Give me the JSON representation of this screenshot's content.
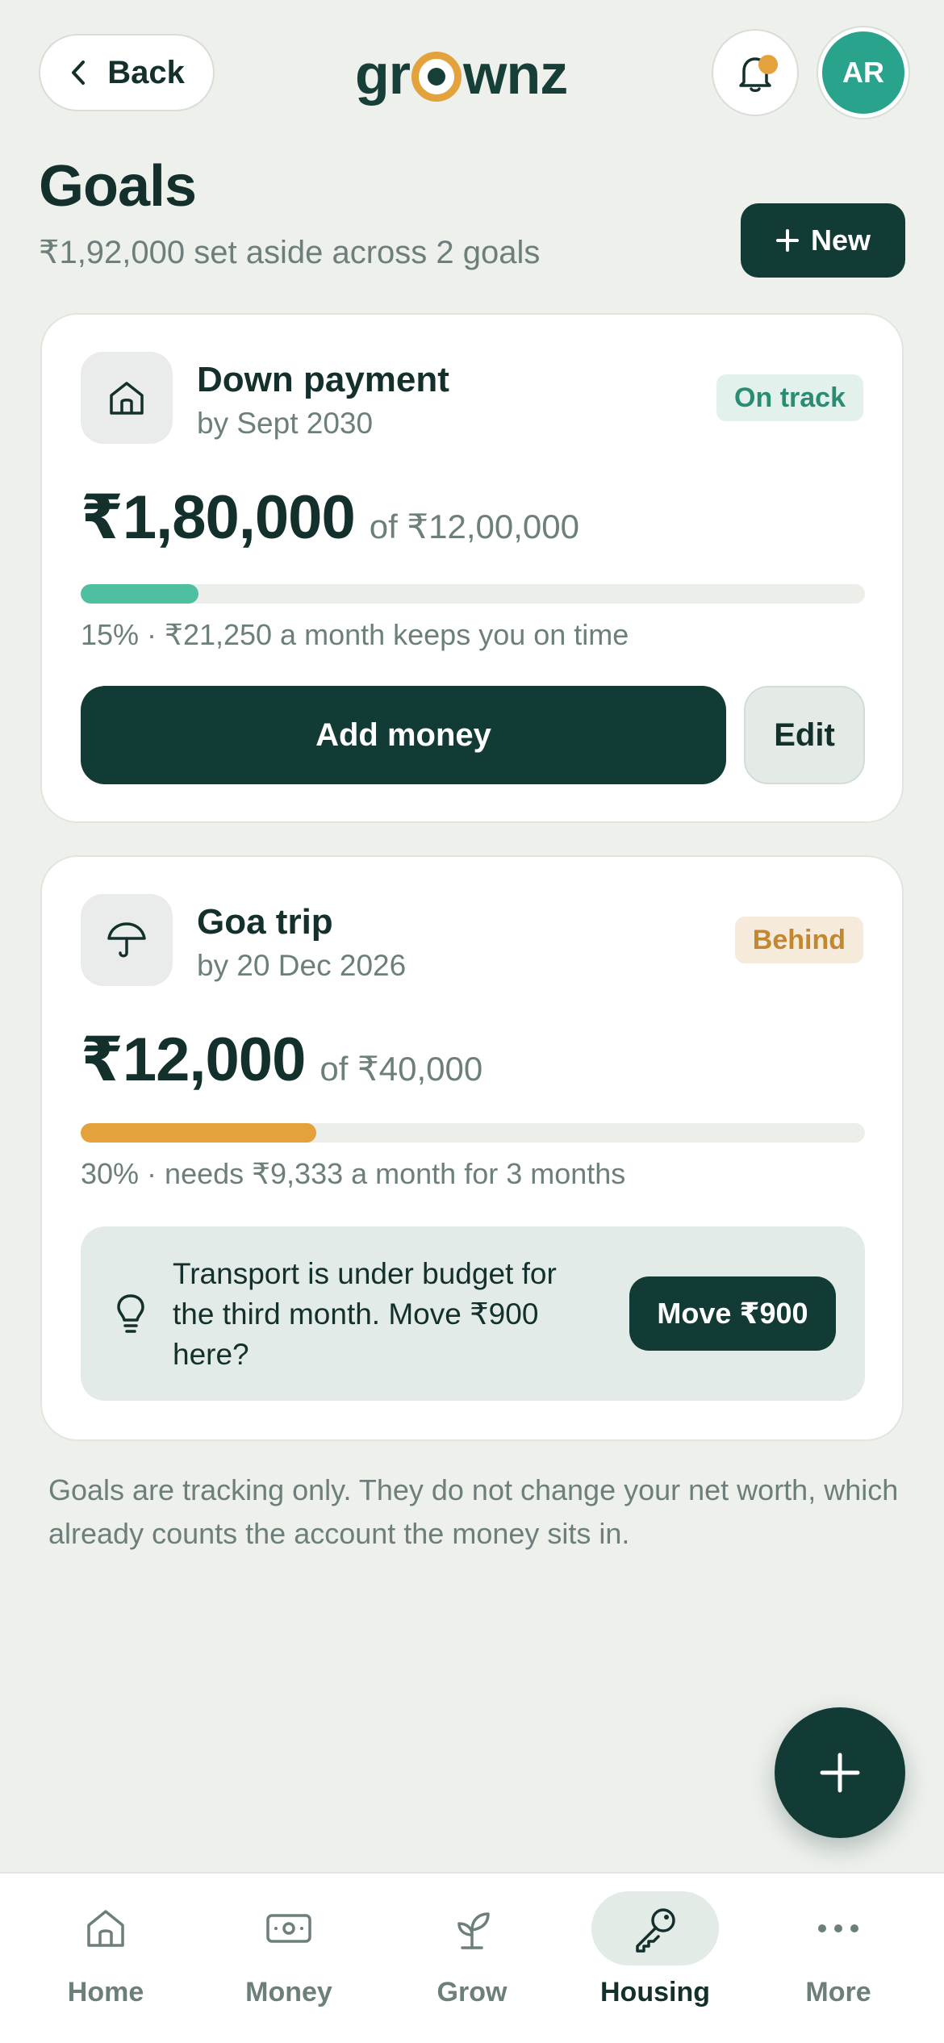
{
  "header": {
    "back_label": "Back",
    "logo_left": "gr",
    "logo_right": "wnz",
    "avatar_initials": "AR"
  },
  "page": {
    "title": "Goals",
    "subtitle": "₹1,92,000 set aside across 2 goals",
    "new_label": "New"
  },
  "goals": [
    {
      "name": "Down payment",
      "date": "by Sept 2030",
      "status": "On track",
      "amount": "₹1,80,000",
      "of_target": "of ₹12,00,000",
      "progress": 0.15,
      "note": "15% · ₹21,250 a month keeps you on time",
      "add_label": "Add money",
      "edit_label": "Edit",
      "icon": "house-icon",
      "bar_color": "#4fbfa2"
    },
    {
      "name": "Goa trip",
      "date": "by 20 Dec 2026",
      "status": "Behind",
      "amount": "₹12,000",
      "of_target": "of ₹40,000",
      "progress": 0.3,
      "note": "30% · needs ₹9,333 a month for 3 months",
      "icon": "umbrella-icon",
      "bar_color": "#e3a23b",
      "tip": {
        "text": "Transport is under budget for the third month. Move ₹900 here?",
        "action_label": "Move ₹900",
        "icon": "lightbulb-icon"
      }
    }
  ],
  "footnote": "Goals are tracking only. They do not change your net worth, which already counts the account the money sits in.",
  "nav": {
    "items": [
      {
        "label": "Home",
        "icon": "home-icon"
      },
      {
        "label": "Money",
        "icon": "banknote-icon"
      },
      {
        "label": "Grow",
        "icon": "sprout-icon"
      },
      {
        "label": "Housing",
        "icon": "key-icon",
        "active": true
      },
      {
        "label": "More",
        "icon": "more-dots-icon"
      }
    ]
  },
  "colors": {
    "background": "#eef0ec",
    "primary": "#123b35",
    "accent_teal": "#2aa38d",
    "accent_orange": "#e3a23b"
  }
}
